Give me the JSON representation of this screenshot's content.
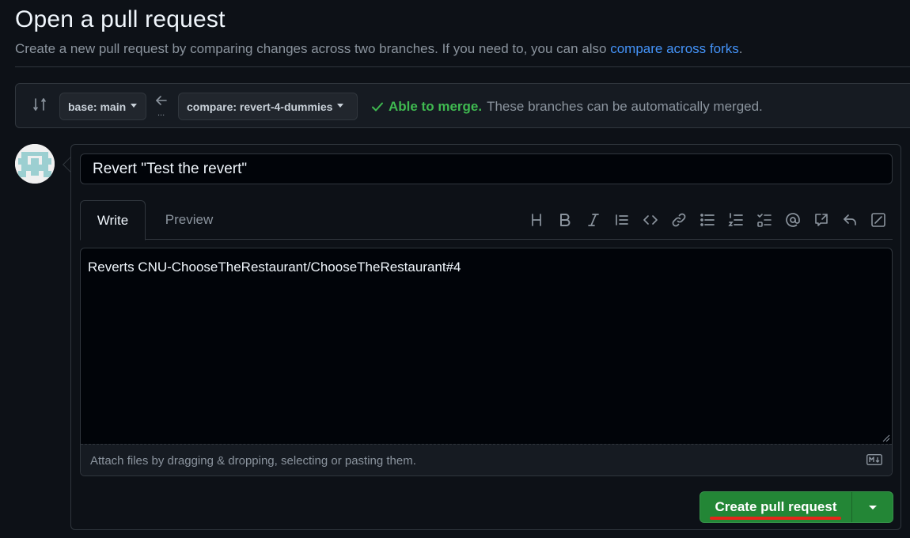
{
  "page": {
    "title": "Open a pull request",
    "subtitle_prefix": "Create a new pull request by comparing changes across two branches. If you need to, you can also ",
    "subtitle_link": "compare across forks",
    "subtitle_suffix": "."
  },
  "range": {
    "base_label": "base: main",
    "compare_label": "compare: revert-4-dummies",
    "ellipsis": "...",
    "merge_ok": "Able to merge.",
    "merge_desc": "These branches can be automatically merged."
  },
  "composer": {
    "title_value": "Revert \"Test the revert\"",
    "tabs": [
      {
        "label": "Write"
      },
      {
        "label": "Preview"
      }
    ],
    "toolbar_icons": [
      "heading-icon",
      "bold-icon",
      "italic-icon",
      "quote-icon",
      "code-icon",
      "link-icon",
      "unordered-list-icon",
      "ordered-list-icon",
      "task-list-icon",
      "mention-icon",
      "reference-icon",
      "reply-icon",
      "edit-icon"
    ],
    "body_value": "Reverts CNU-ChooseTheRestaurant/ChooseTheRestaurant#4",
    "attach_hint": "Attach files by dragging & dropping, selecting or pasting them.",
    "create_label": "Create pull request"
  },
  "colors": {
    "background": "#0d1117",
    "accent_link": "#4493f8",
    "success": "#3fb950",
    "primary_button": "#238636",
    "highlight_underline": "#e5261a"
  }
}
